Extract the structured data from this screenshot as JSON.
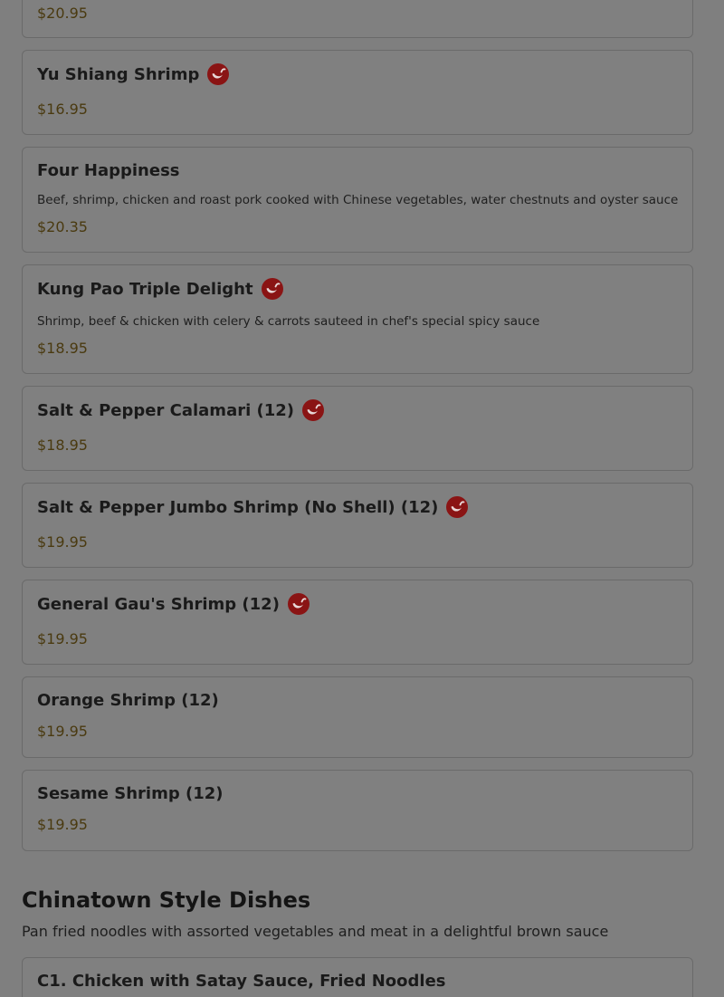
{
  "items": [
    {
      "name": "",
      "description": "",
      "price": "$20.95",
      "spicy": false
    },
    {
      "name": "Yu Shiang Shrimp",
      "description": "",
      "price": "$16.95",
      "spicy": true
    },
    {
      "name": "Four Happiness",
      "description": "Beef, shrimp, chicken and roast pork cooked with Chinese vegetables, water chestnuts and oyster sauce",
      "price": "$20.35",
      "spicy": false
    },
    {
      "name": "Kung Pao Triple Delight",
      "description": "Shrimp, beef & chicken with celery & carrots sauteed in chef's special spicy sauce",
      "price": "$18.95",
      "spicy": true
    },
    {
      "name": "Salt & Pepper Calamari (12)",
      "description": "",
      "price": "$18.95",
      "spicy": true
    },
    {
      "name": "Salt & Pepper Jumbo Shrimp (No Shell) (12)",
      "description": "",
      "price": "$19.95",
      "spicy": true
    },
    {
      "name": "General Gau's Shrimp (12)",
      "description": "",
      "price": "$19.95",
      "spicy": true
    },
    {
      "name": "Orange Shrimp (12)",
      "description": "",
      "price": "$19.95",
      "spicy": false
    },
    {
      "name": "Sesame Shrimp (12)",
      "description": "",
      "price": "$19.95",
      "spicy": false
    }
  ],
  "section": {
    "title": "Chinatown Style Dishes",
    "description": "Pan fried noodles with assorted vegetables and meat in a delightful brown sauce",
    "first_item": {
      "name": "C1. Chicken with Satay Sauce, Fried Noodles"
    }
  },
  "icons": {
    "spicy": "chili-pepper-icon"
  },
  "colors": {
    "spicy_icon": "#8a1414",
    "price": "#4a3a10"
  }
}
